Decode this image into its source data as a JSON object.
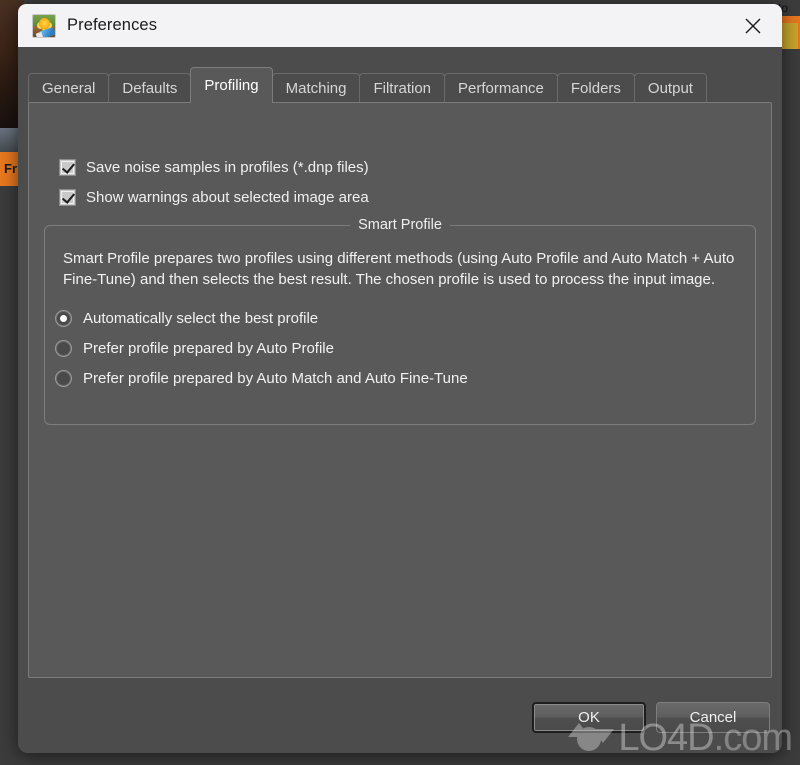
{
  "background": {
    "left_label": "Fr",
    "right_label": "to",
    "accent_orange": "#e8761e",
    "accent_yellow": "#c8a52c"
  },
  "window": {
    "title": "Preferences",
    "icon": "photo-flower-tool-icon",
    "close_label": "✕",
    "titlebar_bg": "#f3f3f5",
    "body_bg": "#4c4c4c",
    "panel_bg": "#59595a"
  },
  "tabs": [
    {
      "label": "General",
      "active": false
    },
    {
      "label": "Defaults",
      "active": false
    },
    {
      "label": "Profiling",
      "active": true
    },
    {
      "label": "Matching",
      "active": false
    },
    {
      "label": "Filtration",
      "active": false
    },
    {
      "label": "Performance",
      "active": false
    },
    {
      "label": "Folders",
      "active": false
    },
    {
      "label": "Output",
      "active": false
    }
  ],
  "panel": {
    "checkboxes": [
      {
        "label": "Save noise samples in profiles (*.dnp files)",
        "checked": true
      },
      {
        "label": "Show warnings about selected image area",
        "checked": true
      }
    ],
    "group": {
      "legend": "Smart Profile",
      "description": "Smart Profile prepares two profiles using different methods (using Auto Profile and Auto Match + Auto Fine-Tune) and then selects the best result. The chosen profile is used to process the input image.",
      "options": [
        {
          "label": "Automatically select the best profile",
          "selected": true
        },
        {
          "label": "Prefer profile prepared by Auto Profile",
          "selected": false
        },
        {
          "label": "Prefer profile prepared by Auto Match and Auto Fine-Tune",
          "selected": false
        }
      ]
    }
  },
  "footer": {
    "ok_label": "OK",
    "cancel_label": "Cancel"
  },
  "watermark": {
    "text_main": "LO4D",
    "text_suffix": ".com"
  }
}
